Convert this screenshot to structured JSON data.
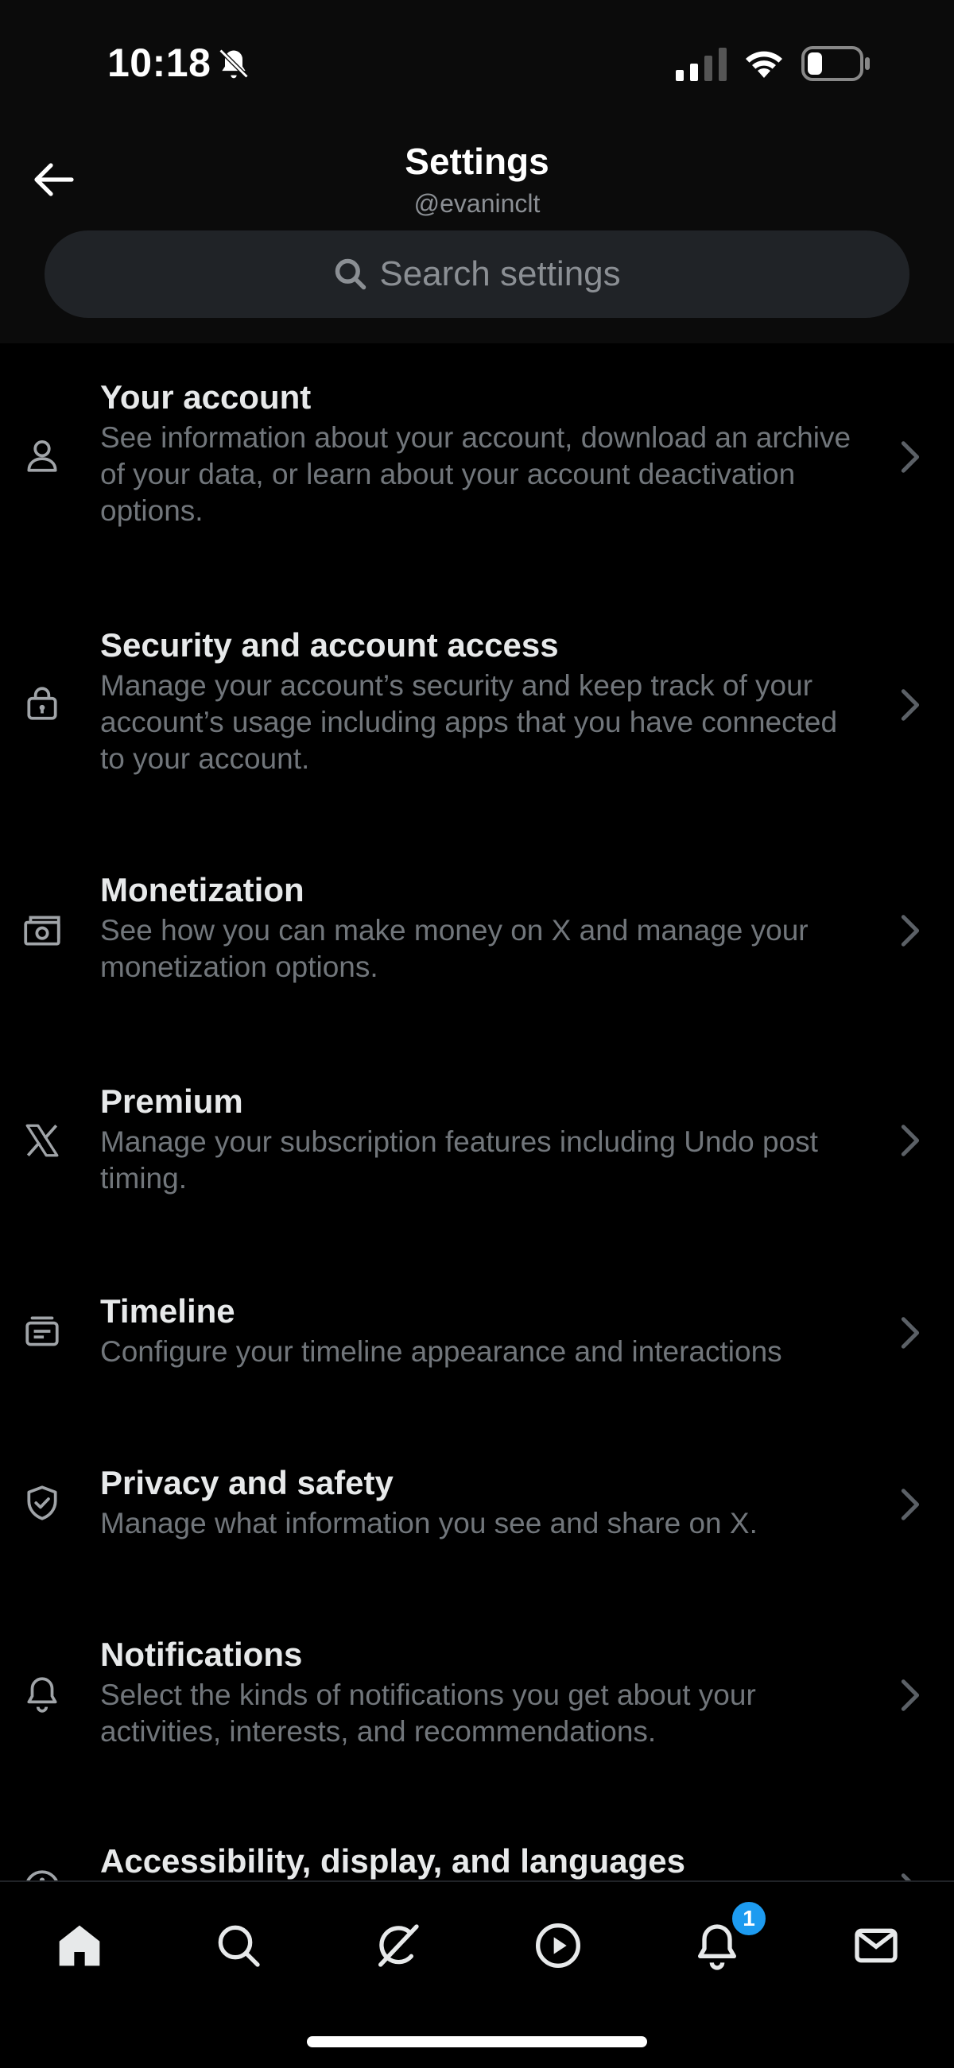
{
  "status_bar": {
    "time": "10:18"
  },
  "header": {
    "title": "Settings",
    "username": "@evaninclt",
    "search_placeholder": "Search settings"
  },
  "settings_items": [
    {
      "title": "Your account",
      "description": "See information about your account, download an archive of your data, or learn about your account deactivation options.",
      "icon": "person-icon"
    },
    {
      "title": "Security and account access",
      "description": "Manage your account’s security and keep track of your account’s usage including apps that you have connected to your account.",
      "icon": "lock-icon"
    },
    {
      "title": "Monetization",
      "description": "See how you can make money on X and manage your monetization options.",
      "icon": "money-icon"
    },
    {
      "title": "Premium",
      "description": "Manage your subscription features including Undo post timing.",
      "icon": "x-logo-icon"
    },
    {
      "title": "Timeline",
      "description": "Configure your timeline appearance and interactions",
      "icon": "timeline-icon"
    },
    {
      "title": "Privacy and safety",
      "description": "Manage what information you see and share on X.",
      "icon": "shield-icon"
    },
    {
      "title": "Notifications",
      "description": "Select the kinds of notifications you get about your activities, interests, and recommendations.",
      "icon": "bell-icon"
    },
    {
      "title": "Accessibility, display, and languages",
      "description": "",
      "icon": "accessibility-icon"
    }
  ],
  "bottom_nav": {
    "items": [
      "home-icon",
      "search-icon",
      "grok-icon",
      "video-icon",
      "notifications-icon",
      "messages-icon"
    ],
    "notification_badge": "1"
  },
  "colors": {
    "accent": "#1d9bf0",
    "background": "#000000",
    "secondary_text": "#71767b"
  }
}
